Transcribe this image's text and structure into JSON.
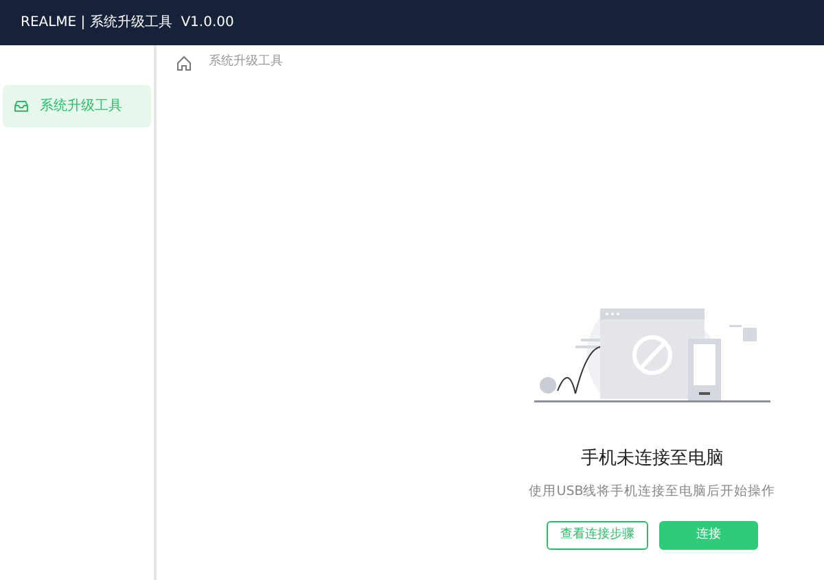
{
  "header": {
    "title": "REALME | 系统升级工具  V1.0.00"
  },
  "sidebar": {
    "items": [
      {
        "label": "系统升级工具",
        "selected": true
      }
    ]
  },
  "breadcrumb": [
    "系统升级工具"
  ],
  "empty_state": {
    "title": "手机未连接至电脑",
    "message": "使用USB线将手机连接至电脑后开始操作",
    "buttons": [
      {
        "label": "查看连接步骤",
        "kind": "outline"
      },
      {
        "label": "连接",
        "kind": "primary"
      }
    ]
  }
}
